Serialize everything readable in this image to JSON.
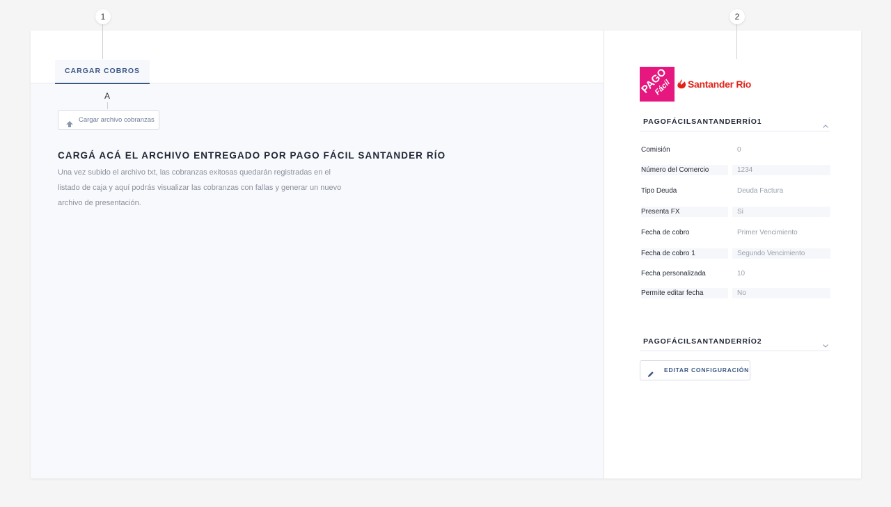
{
  "callouts": {
    "first": "1",
    "second": "2",
    "sub": "A"
  },
  "tabs": [
    {
      "label": "CARGAR COBROS",
      "active": true
    }
  ],
  "upload": {
    "label": "Cargar archivo cobranzas",
    "icon": "upload-icon"
  },
  "main": {
    "heading": "CARGÁ ACÁ EL ARCHIVO ENTREGADO POR PAGO FÁCIL SANTANDER RÍO",
    "lines": [
      "Una vez subido el archivo txt, las cobranzas exitosas quedarán registradas en el",
      "listado de caja y aquí podrás visualizar las cobranzas con fallas y generar un nuevo",
      "archivo de presentación."
    ]
  },
  "logos": {
    "pago_top": "PAGO",
    "pago_bottom": "Fácil",
    "santander": "Santander Río",
    "pago_color": "#e6177e",
    "santander_color": "#e2231a"
  },
  "sections": [
    {
      "title": "PAGOFÁCILSANTANDERRÍO1",
      "expanded": true,
      "icon": "chevron-up-icon",
      "rows": [
        {
          "label": "Comisión",
          "value": "0"
        },
        {
          "label": "Número del Comercio",
          "value": "1234"
        },
        {
          "label": "Tipo Deuda",
          "value": "Deuda Factura"
        },
        {
          "label": "Presenta FX",
          "value": "Si"
        },
        {
          "label": "Fecha de cobro",
          "value": "Primer Vencimiento"
        },
        {
          "label": "Fecha de cobro 1",
          "value": "Segundo Vencimiento"
        },
        {
          "label": "Fecha personalizada",
          "value": "10"
        },
        {
          "label": "Permite editar fecha",
          "value": "No"
        }
      ]
    },
    {
      "title": "PAGOFÁCILSANTANDERRÍO2",
      "expanded": false,
      "icon": "chevron-down-icon",
      "rows": []
    }
  ],
  "edit": {
    "label": "EDITAR CONFIGURACIÓN",
    "icon": "pencil-icon"
  },
  "colors": {
    "accent": "#3a5785",
    "panel_bg": "#f8f9fc",
    "page_bg": "#f5f5f5"
  }
}
